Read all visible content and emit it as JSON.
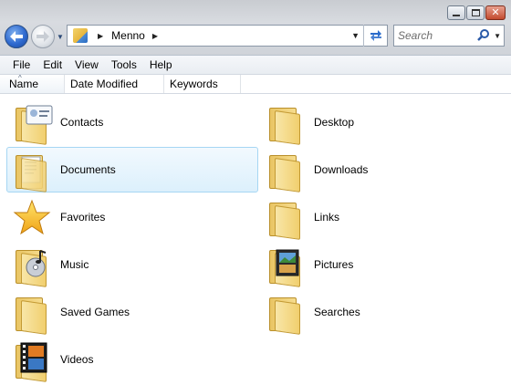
{
  "window": {
    "address": {
      "path": "Menno"
    },
    "search": {
      "placeholder": "Search"
    }
  },
  "menu": [
    "File",
    "Edit",
    "View",
    "Tools",
    "Help"
  ],
  "columns": [
    "Name",
    "Date Modified",
    "Keywords"
  ],
  "folders": [
    {
      "label": "Contacts",
      "icon": "contacts-folder-icon"
    },
    {
      "label": "Desktop",
      "icon": "folder-icon"
    },
    {
      "label": "Documents",
      "icon": "documents-folder-icon",
      "selected": true
    },
    {
      "label": "Downloads",
      "icon": "folder-icon"
    },
    {
      "label": "Favorites",
      "icon": "star-icon"
    },
    {
      "label": "Links",
      "icon": "folder-icon"
    },
    {
      "label": "Music",
      "icon": "music-folder-icon"
    },
    {
      "label": "Pictures",
      "icon": "pictures-folder-icon"
    },
    {
      "label": "Saved Games",
      "icon": "folder-icon"
    },
    {
      "label": "Searches",
      "icon": "folder-icon"
    },
    {
      "label": "Videos",
      "icon": "videos-folder-icon"
    }
  ],
  "colors": {
    "selection_bg": "#dcf0fc",
    "selection_border": "#a6d6f3",
    "folder": "#f1cf6e"
  }
}
